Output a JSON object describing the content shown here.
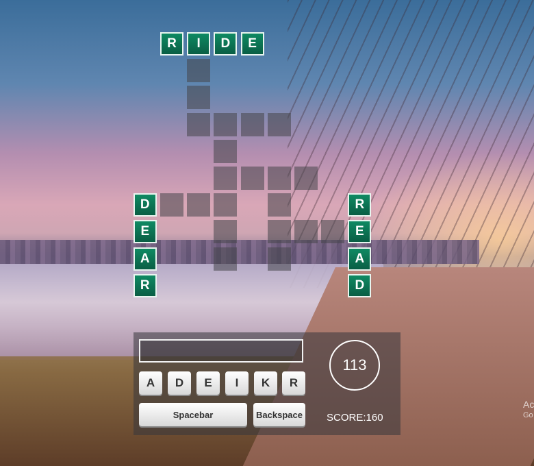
{
  "board": {
    "filled": [
      {
        "letter": "R",
        "col": 0,
        "row": 0
      },
      {
        "letter": "I",
        "col": 1,
        "row": 0
      },
      {
        "letter": "D",
        "col": 2,
        "row": 0
      },
      {
        "letter": "E",
        "col": 3,
        "row": 0
      },
      {
        "letter": "D",
        "col": -1,
        "row": 6
      },
      {
        "letter": "E",
        "col": -1,
        "row": 7
      },
      {
        "letter": "A",
        "col": -1,
        "row": 8
      },
      {
        "letter": "R",
        "col": -1,
        "row": 9
      },
      {
        "letter": "R",
        "col": 7,
        "row": 6
      },
      {
        "letter": "E",
        "col": 7,
        "row": 7
      },
      {
        "letter": "A",
        "col": 7,
        "row": 8
      },
      {
        "letter": "D",
        "col": 7,
        "row": 9
      }
    ],
    "empty": [
      {
        "col": 1,
        "row": 1
      },
      {
        "col": 1,
        "row": 2
      },
      {
        "col": 1,
        "row": 3
      },
      {
        "col": 2,
        "row": 3
      },
      {
        "col": 3,
        "row": 3
      },
      {
        "col": 4,
        "row": 3
      },
      {
        "col": 2,
        "row": 4
      },
      {
        "col": 2,
        "row": 5
      },
      {
        "col": 3,
        "row": 5
      },
      {
        "col": 4,
        "row": 5
      },
      {
        "col": 5,
        "row": 5
      },
      {
        "col": 0,
        "row": 6
      },
      {
        "col": 1,
        "row": 6
      },
      {
        "col": 2,
        "row": 6
      },
      {
        "col": 4,
        "row": 6
      },
      {
        "col": 2,
        "row": 7
      },
      {
        "col": 4,
        "row": 7
      },
      {
        "col": 5,
        "row": 7
      },
      {
        "col": 6,
        "row": 7
      },
      {
        "col": 2,
        "row": 8
      },
      {
        "col": 4,
        "row": 8
      }
    ]
  },
  "controls": {
    "answer_value": "",
    "letters": [
      "A",
      "D",
      "E",
      "I",
      "K",
      "R"
    ],
    "spacebar_label": "Spacebar",
    "backspace_label": "Backspace",
    "timer": "113",
    "score_text": "SCORE:160"
  },
  "watermark": {
    "line1": "Ac",
    "line2": "Go"
  }
}
